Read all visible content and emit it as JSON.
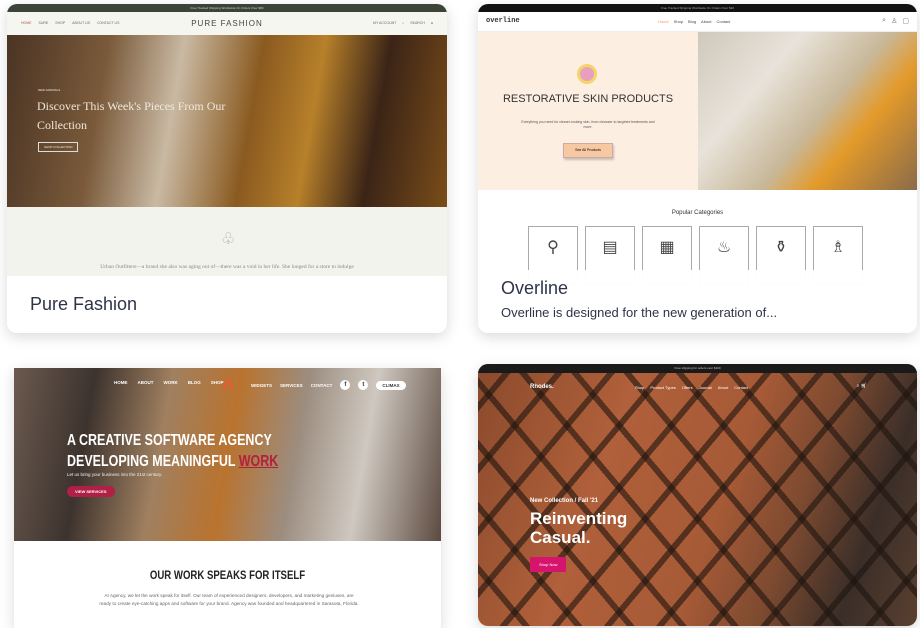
{
  "cards": [
    {
      "title": "Pure Fashion",
      "preview": {
        "announcement": "Free Tracked Shipping Worldwide On Orders Over $80",
        "nav": [
          "HOME",
          "SURE",
          "SHOP",
          "ABOUT US",
          "CONTACT US"
        ],
        "brand": "PURE FASHION",
        "nav_right": [
          "MY ACCOUNT",
          "SEARCH"
        ],
        "tag": "NEW ARRIVALS",
        "headline": "Discover This Week's Pieces From Our Collection",
        "button": "SHOP COLLECTION",
        "quote": "Urban Outfitters—a brand she also was aging out of—there was a void in her life. She longed for a store to indulge"
      }
    },
    {
      "title": "Overline",
      "description": "Overline is designed for the new generation of...",
      "preview": {
        "announcement": "Free Tracked Shipping Worldwide On Orders Over $30",
        "logo": "overline",
        "nav": [
          "Home",
          "Shop",
          "Blog",
          "About",
          "Contact"
        ],
        "headline": "RESTORATIVE SKIN PRODUCTS",
        "subtext": "Everything you need for clearer-looking skin, from cleanser to targeted treatments and more.",
        "button": "See All Products",
        "categories_title": "Popular Categories"
      }
    },
    {
      "preview": {
        "nav_left": [
          "HOME",
          "ABOUT",
          "WORK",
          "BLOG",
          "SHOP"
        ],
        "nav_right": [
          "WIDGETS",
          "SERVICES",
          "CONTACT"
        ],
        "pill": "CLIMAX",
        "headline_1": "A CREATIVE SOFTWARE AGENCY",
        "headline_2": "DEVELOPING MEANINGFUL",
        "headline_accent": "WORK",
        "subtext": "Let us bring your business into the 21st century.",
        "button": "VIEW SERVICES",
        "section_title": "OUR WORK SPEAKS FOR ITSELF",
        "section_text": "At Agency, we let the work speak for itself. Our team of experienced designers, developers, and marketing geniuses, are ready to create eye-catching apps and software for your brand. Agency was founded and headquartered in Sarasota, Florida."
      }
    },
    {
      "preview": {
        "announcement": "Free shipping for orders over $100",
        "logo": "Rhodes.",
        "nav": [
          "Shop",
          "Product Types",
          "Offers",
          "Journal",
          "About",
          "Contact"
        ],
        "tag": "New Collection / Fall '21",
        "headline": "Reinventing Casual.",
        "button": "Shop Now"
      }
    }
  ]
}
